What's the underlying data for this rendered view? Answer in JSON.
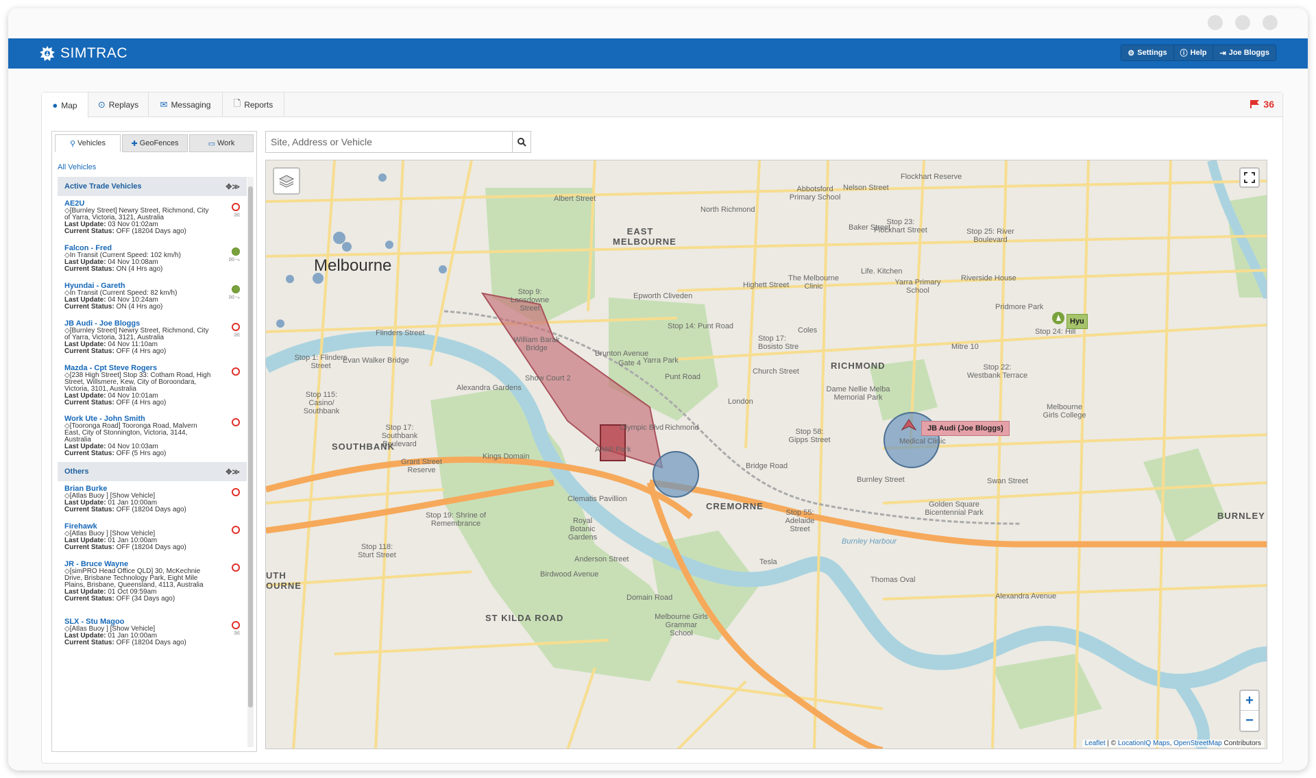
{
  "app": {
    "name": "SIMTRAC",
    "buttons": {
      "settings": "Settings",
      "help": "Help",
      "user": "Joe Bloggs"
    }
  },
  "tabs": [
    {
      "label": "Map",
      "icon": "globe-icon"
    },
    {
      "label": "Replays",
      "icon": "play-circle-icon"
    },
    {
      "label": "Messaging",
      "icon": "envelope-icon"
    },
    {
      "label": "Reports",
      "icon": "file-icon"
    }
  ],
  "alerts": {
    "count": "36",
    "icon": "flag-icon"
  },
  "sidebar": {
    "tabs": [
      {
        "label": "Vehicles",
        "icon": "map-marker-icon"
      },
      {
        "label": "GeoFences",
        "icon": "plus-icon"
      },
      {
        "label": "Work",
        "icon": "monitor-icon"
      }
    ],
    "all_vehicles": "All Vehicles",
    "groups": [
      {
        "title": "Active Trade Vehicles",
        "vehicles": [
          {
            "name": "AE2U",
            "address": "[Burnley Street] Newry Street, Richmond, City of Yarra, Victoria, 3121, Australia",
            "last_update_label": "Last Update:",
            "last_update": "03 Nov 01:02am",
            "status_label": "Current Status:",
            "status": "OFF (18204 Days ago)",
            "state": "off",
            "envelope": true
          },
          {
            "name": "Falcon - Fred",
            "address": "In Transit (Current Speed: 102 km/h)",
            "last_update_label": "Last Update:",
            "last_update": "04 Nov 10:08am",
            "status_label": "Current Status:",
            "status": "ON (4 Hrs ago)",
            "state": "on",
            "envelope": true
          },
          {
            "name": "Hyundai - Gareth",
            "address": "In Transit (Current Speed: 82 km/h)",
            "last_update_label": "Last Update:",
            "last_update": "04 Nov 10:24am",
            "status_label": "Current Status:",
            "status": "ON (4 Hrs ago)",
            "state": "on",
            "envelope": true
          },
          {
            "name": "JB Audi - Joe Bloggs",
            "address": "[Burnley Street] Newry Street, Richmond, City of Yarra, Victoria, 3121, Australia",
            "last_update_label": "Last Update:",
            "last_update": "04 Nov 11:10am",
            "status_label": "Current Status:",
            "status": "OFF (4 Hrs ago)",
            "state": "off",
            "envelope": true
          },
          {
            "name": "Mazda - Cpt Steve Rogers",
            "address": "[238 High Street] Stop 33: Cotham Road, High Street, Willsmere, Kew, City of Boroondara, Victoria, 3101, Australia",
            "last_update_label": "Last Update:",
            "last_update": "04 Nov 10:01am",
            "status_label": "Current Status:",
            "status": "OFF (4 Hrs ago)",
            "state": "off",
            "envelope": false
          },
          {
            "name": "Work Ute - John Smith",
            "address": "[Tooronga Road] Tooronga Road, Malvern East, City of Stonnington, Victoria, 3144, Australia",
            "last_update_label": "Last Update:",
            "last_update": "04 Nov 10:03am",
            "status_label": "Current Status:",
            "status": "OFF (5 Hrs ago)",
            "state": "off",
            "envelope": false
          }
        ]
      },
      {
        "title": "Others",
        "vehicles": [
          {
            "name": "Brian Burke",
            "address": "[Atlas Buoy ] [Show Vehicle]",
            "last_update_label": "Last Update:",
            "last_update": "01 Jan 10:00am",
            "status_label": "Current Status:",
            "status": "OFF (18204 Days ago)",
            "state": "off",
            "envelope": false
          },
          {
            "name": "Firehawk",
            "address": "[Atlas Buoy ] [Show Vehicle]",
            "last_update_label": "Last Update:",
            "last_update": "01 Jan 10:00am",
            "status_label": "Current Status:",
            "status": "OFF (18204 Days ago)",
            "state": "off",
            "envelope": false
          },
          {
            "name": "JR - Bruce Wayne",
            "address": "[simPRO Head Office QLD] 30, McKechnie Drive, Brisbane Technology Park, Eight Mile Plains, Brisbane, Queensland, 4113, Australia",
            "last_update_label": "Last Update:",
            "last_update": "01 Oct 09:59am",
            "status_label": "Current Status:",
            "status": "OFF (34 Days ago)",
            "state": "off",
            "envelope": false
          },
          {
            "name": "SLX - Stu Magoo",
            "address": "[Atlas Buoy ] [Show Vehicle]",
            "last_update_label": "Last Update:",
            "last_update": "01 Jan 10:00am",
            "status_label": "Current Status:",
            "status": "OFF (18204 Days ago)",
            "state": "off",
            "envelope": true
          }
        ]
      }
    ]
  },
  "search": {
    "placeholder": "Site, Address or Vehicle"
  },
  "map": {
    "labels": {
      "melbourne": "Melbourne",
      "east_melbourne": "EAST MELBOURNE",
      "richmond": "RICHMOND",
      "southbank": "SOUTHBANK",
      "cremorne": "CREMORNE",
      "burnley": "BURNLEY",
      "st_kilda_road": "ST KILDA ROAD",
      "south_melbourne": "UTH OURNE",
      "flinders_street": "Flinders Street",
      "william_barak": "William Barak Bridge",
      "yarra_park": "Yarra Park",
      "kings_domain": "Kings Domain",
      "clematis": "Clematis Pavillion",
      "royal_botanic": "Royal Botanic Gardens",
      "alexandra_gardens": "Alexandra Gardens",
      "epworth": "Epworth Cliveden",
      "abbotsford": "Abbotsford Primary School",
      "flockhart": "Flockhart Reserve",
      "north_richmond": "North Richmond",
      "the_melbourne_clinic": "The Melbourne Clinic",
      "life_kitchen": "Life. Kitchen",
      "yarra_primary": "Yarra Primary School",
      "riverside_house": "Riverside House",
      "pridmore_park": "Pridmore Park",
      "dame_nellie": "Dame Nellie Melba Memorial Park",
      "london": "London",
      "coles": "Coles",
      "mitre": "Mitre 10",
      "melbourne_girls": "Melbourne Girls College",
      "golden_square": "Golden Square Bicentennial Park",
      "thomas_oval": "Thomas Oval",
      "tesla": "Tesla",
      "burnley_harbour": "Burnley Harbour",
      "melbourne_grammar": "Melbourne Girls Grammar School",
      "grant_street": "Grant Street Reserve",
      "shrine": "Stop 19: Shrine of Remembrance",
      "aami": "AAMI Park",
      "olympic_blvd": "Olympic Blvd",
      "swan_street": "Swan Street",
      "bridge_road": "Bridge Road",
      "punt_road": "Punt Road",
      "highett_street": "Highett Street",
      "nelson_street": "Nelson Street",
      "baker_street": "Baker Street",
      "albert_street": "Albert Street",
      "brunton_avenue": "Brunton Avenue",
      "domain_road": "Domain Road",
      "alexandra_ave": "Alexandra Avenue",
      "birdwood": "Birdwood Avenue",
      "anderson_street": "Anderson Street",
      "church_street": "Church Street",
      "burnley_street": "Burnley Street",
      "gate4": "Gate 4",
      "show_court": "Show Court 2",
      "stop_9": "Stop 9: Lansdowne Street",
      "stop_14": "Stop 14: Punt Road",
      "stop_17": "Stop 17: Bosisto Stre",
      "stop_23": "Stop 23: Flockhart Street",
      "stop_25": "Stop 25: River Boulevard",
      "stop_24": "Stop 24: Hill",
      "stop_22": "Stop 22: Westbank Terrace",
      "stop_58": "Stop 58: Gipps Street",
      "stop_55": "Stop 55: Adelaide Street",
      "stop_115": "Stop 115: Casino/ Southbank",
      "stop_17b": "Stop 17: Southbank Boulevard",
      "stop_118": "Stop 118: Sturt Street",
      "stop_1": "Stop 1: Flinders Street",
      "evan_walker": "Evan Walker Bridge",
      "medical_clinic": "Medical Clinic",
      "richmond_station": "Richmond",
      "hyundai": "Hyu",
      "vehicle_tag": "JB Audi (Joe Bloggs)"
    },
    "attribution": {
      "leaflet": "Leaflet",
      "sep": " | © ",
      "liq": "LocationIQ Maps",
      "comma": ", ",
      "osm": "OpenStreetMap",
      "tail": " Contributors"
    },
    "zoom_in": "+",
    "zoom_out": "−",
    "colors": {
      "water": "#aad3df",
      "park": "#c8dfb6",
      "road_major": "#f6a95a",
      "road_minor": "#f7dd8f",
      "land": "#eceae3",
      "geofence": "#c66f78",
      "circle": "#6d95bd"
    }
  },
  "colors": {
    "brand": "#1668b8",
    "alert": "#e0302a",
    "on": "#79a23c"
  }
}
